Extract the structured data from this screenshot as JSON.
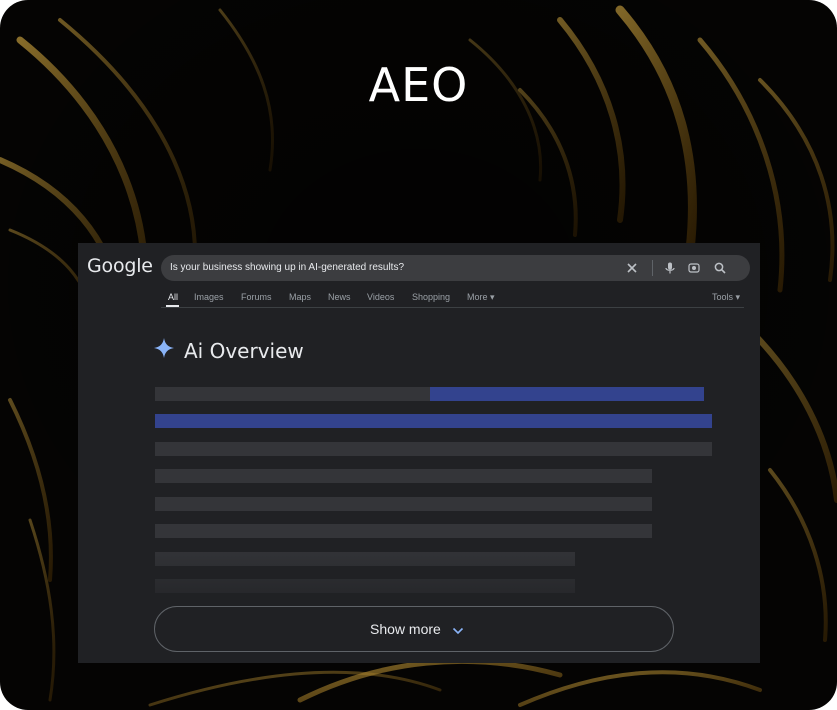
{
  "heading": "AEO",
  "search": {
    "logo": "Google",
    "query": "Is your business showing up in AI-generated results?",
    "icons": [
      "close-icon",
      "microphone-icon",
      "camera-icon",
      "search-icon"
    ]
  },
  "tabs": [
    {
      "label": "All",
      "active": true
    },
    {
      "label": "Images",
      "active": false
    },
    {
      "label": "Forums",
      "active": false
    },
    {
      "label": "Maps",
      "active": false
    },
    {
      "label": "News",
      "active": false
    },
    {
      "label": "Videos",
      "active": false
    },
    {
      "label": "Shopping",
      "active": false
    },
    {
      "label": "More ▾",
      "active": false
    }
  ],
  "tools_label": "Tools ▾",
  "ai_overview": {
    "title": "Ai Overview",
    "icon": "sparkle-icon",
    "show_more_label": "Show more"
  },
  "colors": {
    "background": "#050403",
    "window": "#202124",
    "placeholder_grey": "#343539",
    "placeholder_blue": "#33438e",
    "sparkle": "#8ab4f8",
    "accent_gold": "#d49a1a"
  }
}
